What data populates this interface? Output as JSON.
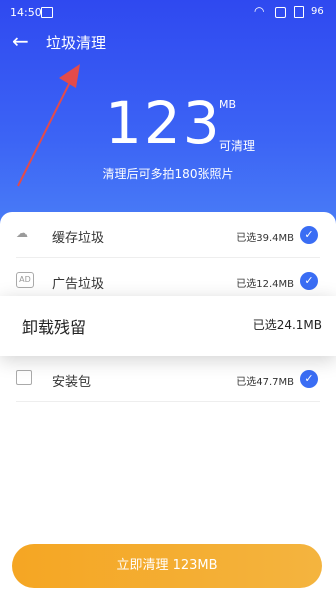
{
  "status_bar": {
    "time": "14:50",
    "battery": "96",
    "icons": [
      "gallery-icon",
      "wifi-icon",
      "square-icon",
      "sim-icon",
      "battery-icon"
    ]
  },
  "header": {
    "title": "垃圾清理",
    "back_icon": "arrow-left-icon"
  },
  "summary": {
    "value": "123",
    "unit": "MB",
    "caption": "可清理",
    "subtitle": "清理后可多拍180张照片"
  },
  "items": [
    {
      "icon": "cloud-icon",
      "label": "缓存垃圾",
      "size": "已选39.4MB"
    },
    {
      "icon": "ad-icon",
      "label": "广告垃圾",
      "size": "已选12.4MB"
    },
    {
      "icon": "uninstall-icon",
      "label": "卸载残留",
      "size": "已选24.1MB"
    },
    {
      "icon": "package-icon",
      "label": "安装包",
      "size": "已选47.7MB"
    }
  ],
  "action": {
    "label": "立即清理 123MB"
  },
  "colors": {
    "header_blue": "#3b5ff3",
    "accent_orange": "#f5a623",
    "check_blue": "#3a6df4",
    "arrow_red": "#e34b4b"
  }
}
